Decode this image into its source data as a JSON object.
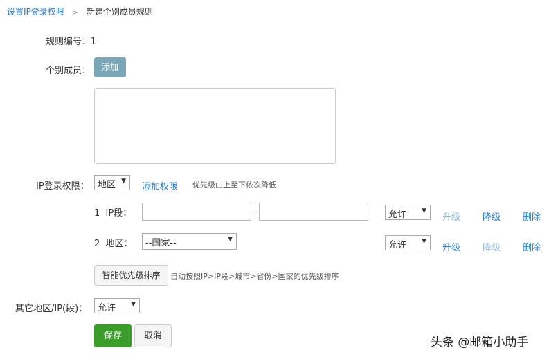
{
  "breadcrumb": {
    "parent": "设置IP登录权限",
    "sep": ">",
    "current": "新建个别成员规则"
  },
  "rule_no": {
    "label": "规则编号：",
    "value": "1"
  },
  "members": {
    "label": "个别成员：",
    "add_button": "添加",
    "textarea_value": ""
  },
  "ip_perm": {
    "label": "IP登录权限：",
    "type_select": "地区",
    "add_link": "添加权限",
    "hint": "优先级由上至下依次降低"
  },
  "rules": [
    {
      "index": "1",
      "type": "IP段：",
      "start": "",
      "sep": "--",
      "end": "",
      "action": "允许",
      "up": "升级",
      "down": "降级",
      "delete": "删除",
      "up_enabled": false,
      "down_enabled": true
    },
    {
      "index": "2",
      "type": "地区：",
      "country": "--国家--",
      "action": "允许",
      "up": "升级",
      "down": "降级",
      "delete": "删除",
      "up_enabled": true,
      "down_enabled": false
    }
  ],
  "sort": {
    "button": "智能优先级排序",
    "hint": "自动按照IP>IP段>城市>省份>国家的优先级排序"
  },
  "other": {
    "label": "其它地区/IP(段)：",
    "action": "允许"
  },
  "actions": {
    "save": "保存",
    "cancel": "取消"
  },
  "watermark": "头条 @邮箱小助手",
  "colors": {
    "link": "#2f7bbd",
    "disabled_link": "#93b9dc",
    "add_button": "#7aa6b6",
    "save": "#3a9d2a"
  }
}
